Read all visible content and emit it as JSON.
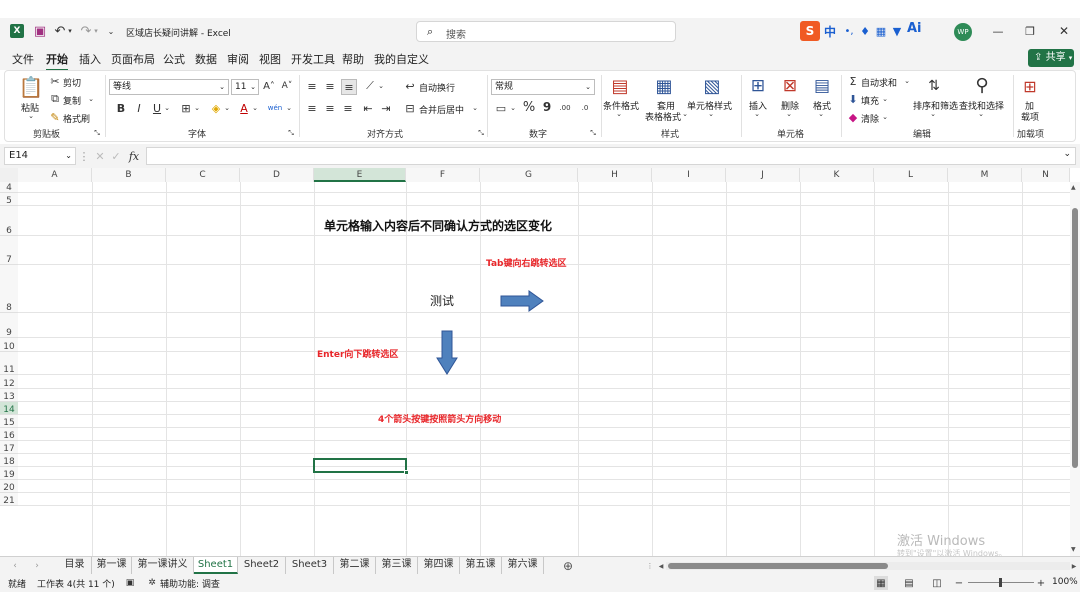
{
  "titlebar": {
    "title": "区域店长疑问讲解 - Excel",
    "search_placeholder": "搜索",
    "ime": "中",
    "ai": "Ai",
    "avatar": "WP"
  },
  "menu": {
    "items": [
      "文件",
      "开始",
      "插入",
      "页面布局",
      "公式",
      "数据",
      "审阅",
      "视图",
      "开发工具",
      "帮助",
      "我的自定义"
    ],
    "active": "开始",
    "share": "共享"
  },
  "ribbon": {
    "clipboard": {
      "paste": "粘贴",
      "cut": "剪切",
      "copy": "复制",
      "format_painter": "格式刷",
      "label": "剪贴板"
    },
    "font": {
      "name": "等线",
      "size": "11",
      "bold": "B",
      "italic": "I",
      "underline": "U",
      "label": "字体"
    },
    "alignment": {
      "wrap": "自动换行",
      "merge": "合并后居中",
      "label": "对齐方式"
    },
    "number": {
      "format": "常规",
      "percent": "%",
      "comma": "9",
      "label": "数字"
    },
    "styles": {
      "conditional": "条件格式",
      "table_line1": "套用",
      "table_line2": "表格格式",
      "cell_style": "单元格样式",
      "label": "样式"
    },
    "cells": {
      "insert": "插入",
      "delete": "删除",
      "format": "格式",
      "label": "单元格"
    },
    "editing": {
      "autosum": "自动求和",
      "fill": "填充",
      "clear": "清除",
      "sort": "排序和筛选",
      "find": "查找和选择",
      "label": "编辑"
    },
    "addins": {
      "line1": "加",
      "line2": "载项",
      "label": "加载项"
    }
  },
  "formula_bar": {
    "name_box": "E14",
    "fx": "fx",
    "content": ""
  },
  "columns": [
    "A",
    "B",
    "C",
    "D",
    "E",
    "F",
    "G",
    "H",
    "I",
    "J",
    "K",
    "L",
    "M",
    "N"
  ],
  "rows": [
    "4",
    "5",
    "6",
    "7",
    "8",
    "9",
    "10",
    "11",
    "12",
    "13",
    "14",
    "15",
    "16",
    "17",
    "18",
    "19",
    "20",
    "21"
  ],
  "sheet": {
    "title": "单元格输入内容后不同确认方式的选区变化",
    "tab_note": "Tab键向右跳转选区",
    "test_text": "测试",
    "enter_note": "Enter向下跳转选区",
    "arrow_note": "4个箭头按键按照箭头方向移动",
    "accent_red": "#e8262a",
    "arrow_fill": "#4f81bd",
    "arrow_stroke": "#2f5597"
  },
  "tabs": {
    "items": [
      "目录",
      "第一课",
      "第一课讲义",
      "Sheet1",
      "Sheet2",
      "Sheet3",
      "第二课",
      "第三课",
      "第四课",
      "第五课",
      "第六课"
    ],
    "active": "Sheet1"
  },
  "status": {
    "ready": "就绪",
    "count": "工作表 4(共 11 个)",
    "accessibility": "辅助功能: 调查",
    "zoom": "100%"
  },
  "watermark": {
    "line1": "激活 Windows",
    "line2": "转到\"设置\"以激活 Windows。"
  },
  "colors": {
    "excel_green": "#217346",
    "chrome": "#f3f3f3"
  }
}
